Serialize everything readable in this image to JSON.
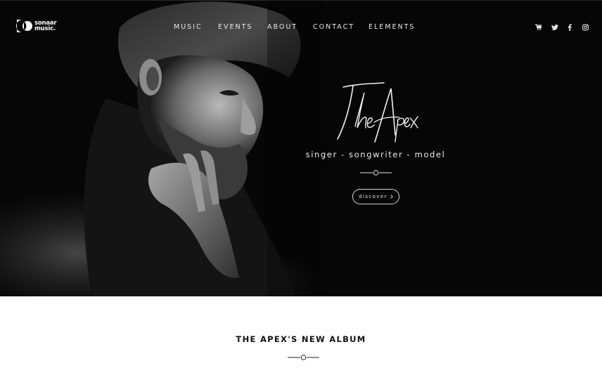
{
  "brand": {
    "logo_line1": "sonaar",
    "logo_line2": "music."
  },
  "nav": {
    "items": [
      "MUSIC",
      "EVENTS",
      "ABOUT",
      "CONTACT",
      "ELEMENTS"
    ]
  },
  "social": {
    "icons": [
      "cart-icon",
      "twitter-icon",
      "facebook-icon",
      "instagram-icon"
    ]
  },
  "hero": {
    "title": "The Apex",
    "tagline": "singer - songwriter - model",
    "discover_label": "discover",
    "discover_icon": "chevron-right-icon"
  },
  "album": {
    "heading": "THE APEX'S NEW ALBUM"
  },
  "colors": {
    "hero_bg": "#060606",
    "text_light": "#ffffff",
    "text_dark": "#111111"
  }
}
